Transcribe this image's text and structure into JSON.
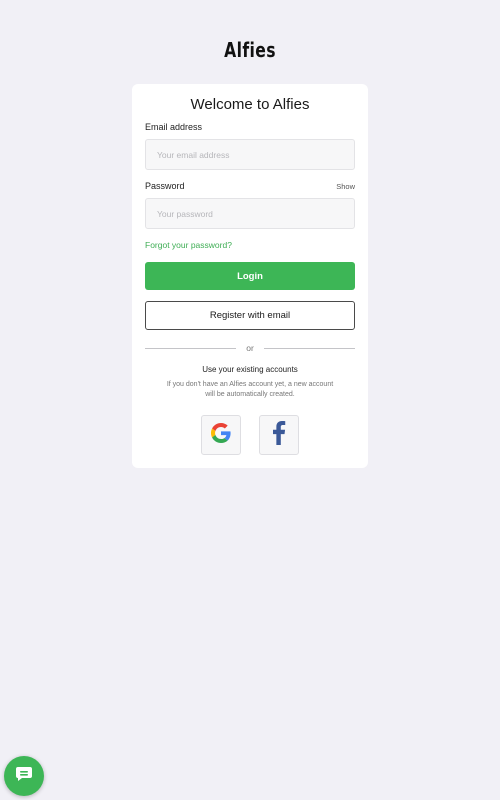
{
  "brand": {
    "logo_text": "Alfies"
  },
  "card": {
    "title": "Welcome to Alfies",
    "email": {
      "label": "Email address",
      "placeholder": "Your email address",
      "value": ""
    },
    "password": {
      "label": "Password",
      "placeholder": "Your password",
      "value": "",
      "show_label": "Show"
    },
    "forgot_label": "Forgot your password?",
    "login_label": "Login",
    "register_label": "Register with email",
    "divider_text": "or",
    "existing_accounts_title": "Use your existing accounts",
    "existing_accounts_note": "If you don't have an Alfies account yet, a new account will be automatically created.",
    "social": [
      {
        "name": "Google",
        "icon": "google-icon"
      },
      {
        "name": "Facebook",
        "icon": "facebook-icon"
      }
    ]
  },
  "chat": {
    "icon": "chat-icon"
  },
  "colors": {
    "background": "#f1f0f6",
    "accent": "#3db656",
    "link": "#3fae55",
    "facebook": "#3b5998"
  }
}
